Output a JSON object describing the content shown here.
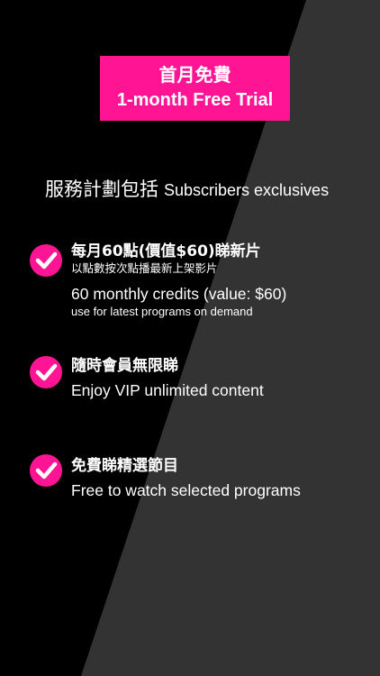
{
  "colors": {
    "background_dark": "#000000",
    "background_panel": "#333333",
    "accent": "#ff1493",
    "text": "#ffffff"
  },
  "promo": {
    "line1": "首月免費",
    "line2": "1-month Free Trial"
  },
  "heading": {
    "zh": "服務計劃包括",
    "en": "Subscribers exclusives"
  },
  "features": [
    {
      "icon": "checkmark-circle-icon",
      "title_zh": "每月60點(價值$60)睇新片",
      "subtitle_zh": "以點數按次點播最新上架影片",
      "title_en": "60 monthly credits (value: $60)",
      "subtitle_en": "use for latest programs on demand"
    },
    {
      "icon": "checkmark-circle-icon",
      "title_zh": "隨時會員無限睇",
      "title_en": "Enjoy VIP unlimited content"
    },
    {
      "icon": "checkmark-circle-icon",
      "title_zh": "免費睇精選節目",
      "title_en": "Free to watch selected programs"
    }
  ]
}
